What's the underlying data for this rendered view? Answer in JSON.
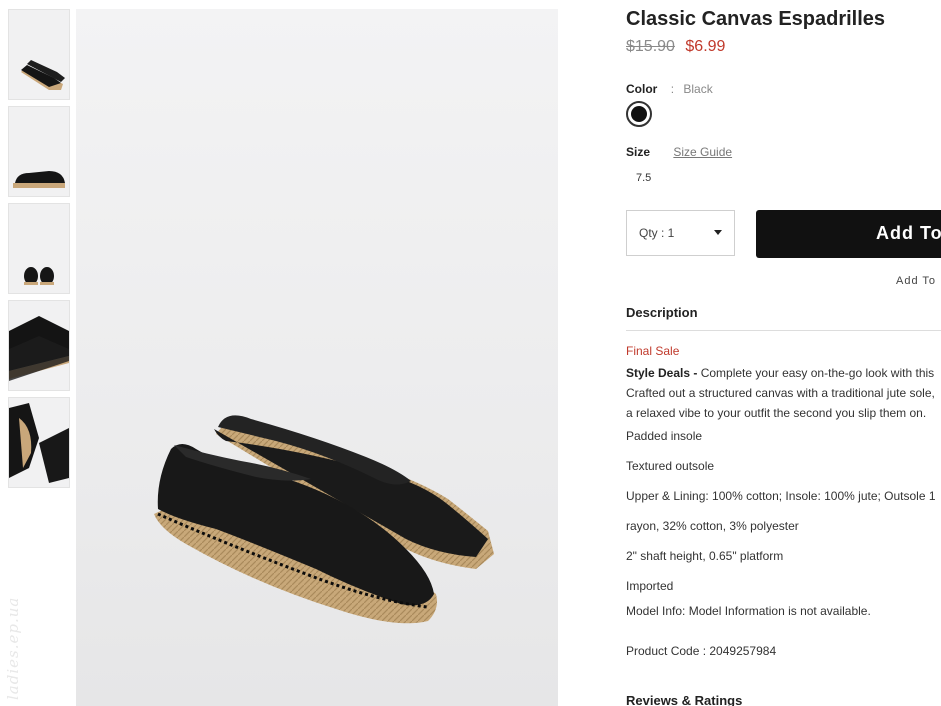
{
  "product": {
    "title": "Classic Canvas Espadrilles",
    "price_original": "$15.90",
    "price_sale": "$6.99"
  },
  "color": {
    "label": "Color",
    "separator": ":",
    "value": "Black",
    "swatch_color": "#111111"
  },
  "size": {
    "label": "Size",
    "guide_link": "Size Guide",
    "selected": "7.5"
  },
  "cart": {
    "qty_label": "Qty : 1",
    "add_button": "Add To",
    "wishlist_link": "Add To"
  },
  "description": {
    "heading": "Description",
    "final_sale": "Final Sale",
    "lead_bold": "Style Deals -",
    "lead_line1": " Complete your easy on-the-go look with this",
    "lead_line2": "Crafted out a structured canvas with a traditional jute sole,",
    "lead_line3": "a relaxed vibe to your outfit the second you slip them on.",
    "bullets": [
      "Padded insole",
      "Textured outsole",
      "Upper & Lining: 100% cotton; Insole: 100% jute; Outsole 1",
      "rayon, 32% cotton, 3% polyester",
      "2\" shaft height, 0.65\" platform",
      "Imported",
      "Model Info: Model Information is not available.",
      "Product Code : 2049257984"
    ]
  },
  "reviews": {
    "heading": "Reviews & Ratings"
  },
  "watermark": "ladies.ep.ua",
  "colors": {
    "accent_red": "#c0392b",
    "button_black": "#111111"
  }
}
